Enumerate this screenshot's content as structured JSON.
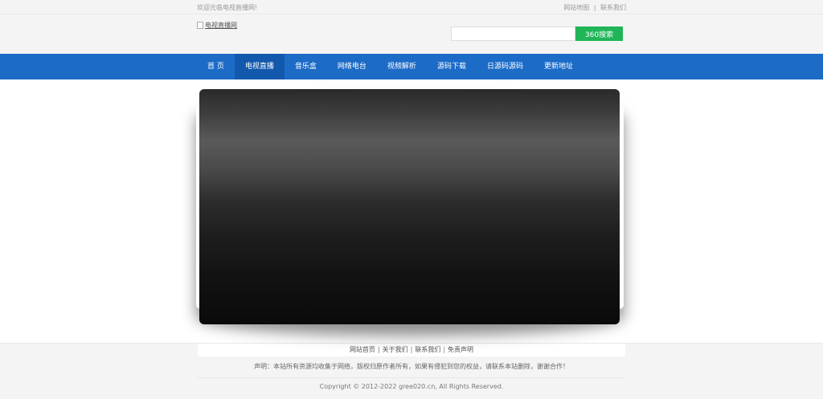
{
  "topbar": {
    "welcome": "欢迎光临电视直播网!",
    "links": [
      {
        "label": "网站地图"
      },
      {
        "label": "联系我们"
      }
    ],
    "separator": "|"
  },
  "header": {
    "logo_alt": "电视直播网",
    "search_placeholder": "",
    "search_button": "360搜索"
  },
  "nav": {
    "items": [
      {
        "label": "首 页"
      },
      {
        "label": "电视直播",
        "active": true
      },
      {
        "label": "音乐盒"
      },
      {
        "label": "网络电台"
      },
      {
        "label": "视频解析"
      },
      {
        "label": "源码下载"
      },
      {
        "label": "日源码源码"
      },
      {
        "label": "更新地址"
      }
    ]
  },
  "footer": {
    "links": [
      {
        "label": "网站首页"
      },
      {
        "label": "关于我们"
      },
      {
        "label": "联系我们"
      },
      {
        "label": "免责声明"
      }
    ],
    "separator": "|",
    "disclaimer": "声明：本站所有资源均收集于网络，版权归原作者所有，如果有侵犯到您的权益，请联系本站删除，谢谢合作！",
    "copyright": "Copyright © 2012-2022 gree020.cn, All Rights Reserved."
  },
  "colors": {
    "nav_bg": "#1b6bc7",
    "nav_active": "#1259ad",
    "search_button": "#21b558"
  }
}
